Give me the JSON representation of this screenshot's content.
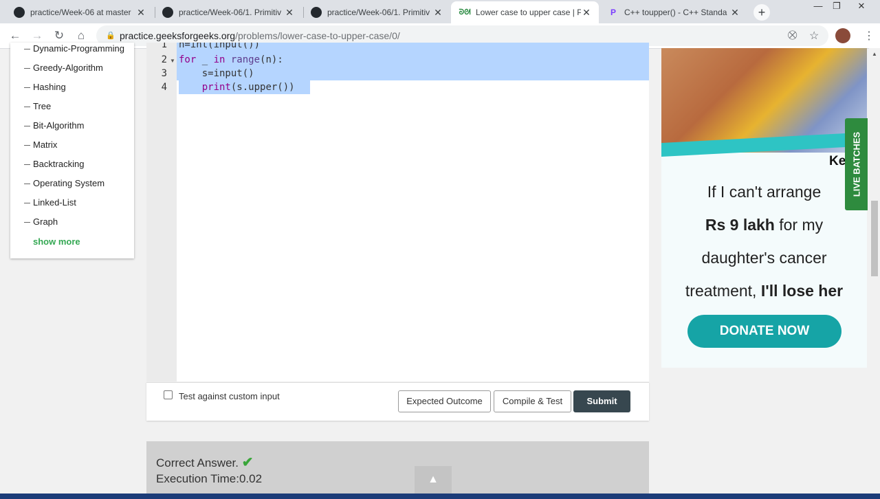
{
  "browser": {
    "tabs": [
      {
        "title": "practice/Week-06 at master",
        "icon": "github-icon",
        "active": false
      },
      {
        "title": "practice/Week-06/1. Primitiv",
        "icon": "github-icon",
        "active": false
      },
      {
        "title": "practice/Week-06/1. Primitiv",
        "icon": "github-icon",
        "active": false
      },
      {
        "title": "Lower case to upper case | P",
        "icon": "geeksforgeeks-icon",
        "active": true
      },
      {
        "title": "C++ toupper() - C++ Standa",
        "icon": "programiz-icon",
        "active": false
      }
    ],
    "url_host": "practice.geeksforgeeks.org",
    "url_path": "/problems/lower-case-to-upper-case/0/"
  },
  "sidebar": {
    "partial_item": "Dynamic-Programming",
    "items": [
      "Greedy-Algorithm",
      "Hashing",
      "Tree",
      "Bit-Algorithm",
      "Matrix",
      "Backtracking",
      "Operating System",
      "Linked-List",
      "Graph"
    ],
    "show_more": "show more"
  },
  "editor": {
    "line_numbers": [
      "1",
      "2",
      "3",
      "4"
    ],
    "lines": [
      {
        "partial": "n=int(input())"
      },
      {
        "keyword": "for",
        "text": " _ ",
        "keyword2": "in",
        "fn": " range",
        "rest": "(n):"
      },
      {
        "indent": "    ",
        "text": "s=input()"
      },
      {
        "indent": "    ",
        "fn": "print",
        "rest": "(s.upper())"
      }
    ]
  },
  "actions": {
    "custom_input_label": "Test against custom input",
    "custom_input_checked": false,
    "expected_outcome": "Expected Outcome",
    "compile_test": "Compile & Test",
    "submit": "Submit"
  },
  "result": {
    "status": "Correct Answer.",
    "execution_time": "Execution Time:0.02"
  },
  "ad": {
    "partial_text": "Ke",
    "line1": "If I can't arrange",
    "line2_bold": "Rs 9 lakh",
    "line2_rest": " for my",
    "line3": "daughter's cancer",
    "line4": "treatment, ",
    "line4_bold": "I'll lose her",
    "donate": "DONATE NOW",
    "live_batches": "LIVE BATCHES"
  }
}
